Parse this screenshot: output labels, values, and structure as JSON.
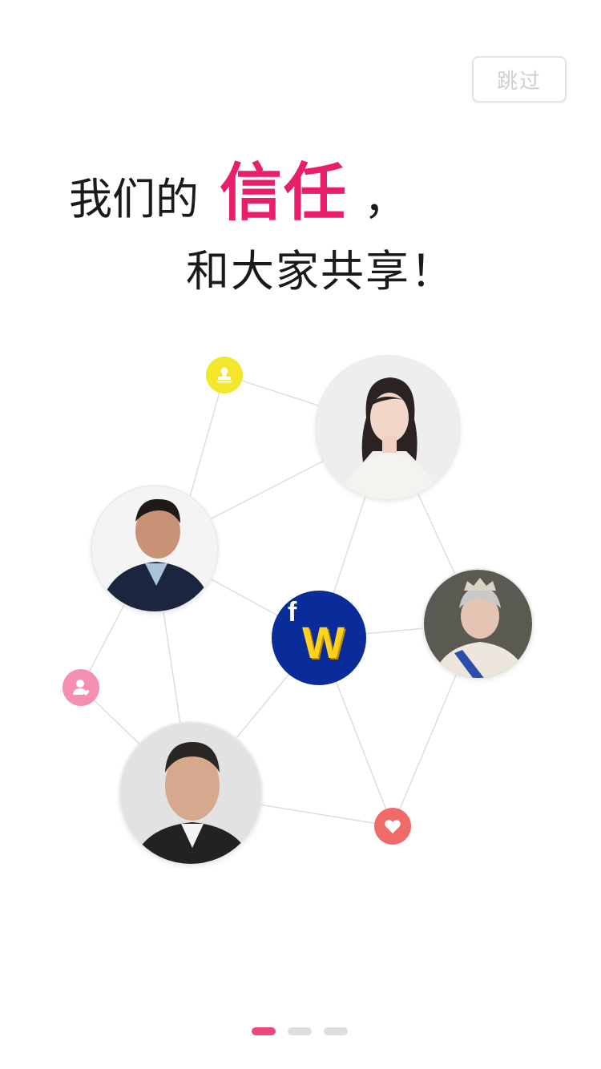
{
  "skip_button": {
    "label": "跳过"
  },
  "headline": {
    "line1_prefix": "我们的",
    "line1_highlight": "信任",
    "line1_suffix": "，",
    "line2": "和大家共享！"
  },
  "logo": {
    "letter_f": "f",
    "letter_w": "W"
  },
  "icons": {
    "yellow": "stamp-icon",
    "pink": "user-heart-icon",
    "red": "heart-icon"
  },
  "colors": {
    "accent": "#ea1f6c",
    "yellow_icon": "#f2e72a",
    "pink_icon": "#f48fb1",
    "red_icon": "#f06a6a",
    "logo_bg": "#0a2c9a",
    "logo_w": "#ffd21f",
    "dot_active": "#f0477a",
    "dot_inactive": "#dedede"
  },
  "pagination": {
    "total": 3,
    "active": 0
  }
}
